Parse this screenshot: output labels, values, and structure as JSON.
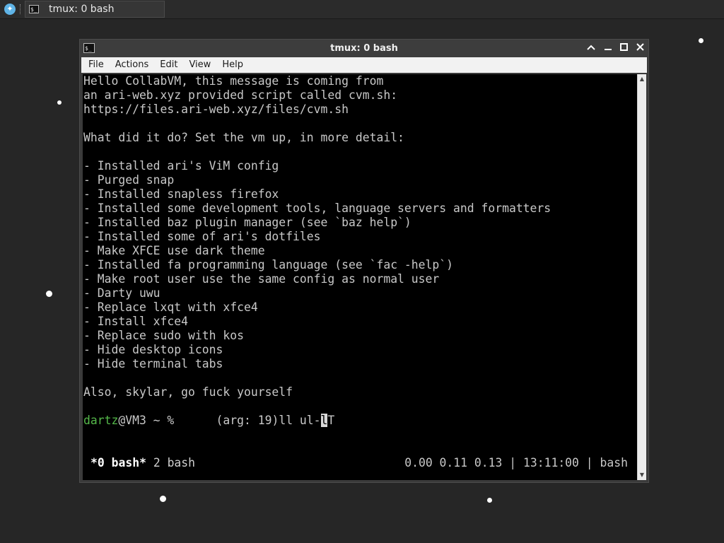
{
  "panel": {
    "task_title": "tmux: 0 bash",
    "task_icon": "terminal-icon"
  },
  "window": {
    "title": "tmux: 0 bash",
    "controls": [
      "minimize",
      "maximize",
      "close"
    ]
  },
  "menu": [
    "File",
    "Actions",
    "Edit",
    "View",
    "Help"
  ],
  "terminal": {
    "lines": [
      "Hello CollabVM, this message is coming from",
      "an ari-web.xyz provided script called cvm.sh:",
      "https://files.ari-web.xyz/files/cvm.sh",
      "",
      "What did it do? Set the vm up, in more detail:",
      "",
      "- Installed ari's ViM config",
      "- Purged snap",
      "- Installed snapless firefox",
      "- Installed some development tools, language servers and formatters",
      "- Installed baz plugin manager (see `baz help`)",
      "- Installed some of ari's dotfiles",
      "- Make XFCE use dark theme",
      "- Installed fa programming language (see `fac -help`)",
      "- Make root user use the same config as normal user",
      "- Darty uwu",
      "- Replace lxqt with xfce4",
      "- Install xfce4",
      "- Replace sudo with kos",
      "- Hide desktop icons",
      "- Hide terminal tabs",
      "",
      "Also, skylar, go fuck yourself",
      ""
    ],
    "prompt": {
      "user": "dartz",
      "host_path": "@VM3 ~ %",
      "arg": "(arg: 19)",
      "command_before_cursor": "ll ul-",
      "cursor_char": "l",
      "command_after_cursor": "T"
    },
    "status": {
      "active_window": "*0 bash*",
      "other_window": "2 bash",
      "right": "0.00 0.11 0.13 | 13:11:00 | bash"
    }
  },
  "colors": {
    "prompt_user": "#55b84a",
    "terminal_bg": "#000000",
    "terminal_fg": "#c8c8c8",
    "desktop_bg": "#262626"
  }
}
